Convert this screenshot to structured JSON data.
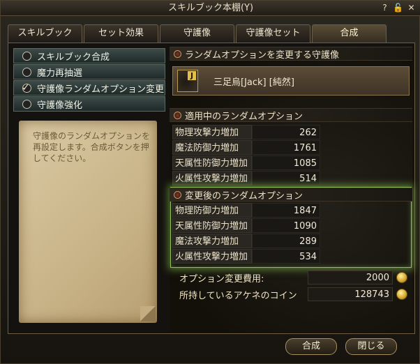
{
  "window": {
    "title": "スキルブック本棚(Y)",
    "icons": [
      "help-icon",
      "lock-icon",
      "close-icon"
    ],
    "icon_glyphs": [
      "?",
      "🔓",
      "✕"
    ]
  },
  "tabs": [
    {
      "label": "スキルブック",
      "active": false
    },
    {
      "label": "セット効果",
      "active": false
    },
    {
      "label": "守護像",
      "active": false
    },
    {
      "label": "守護像セット",
      "active": false
    },
    {
      "label": "合成",
      "active": true
    }
  ],
  "left_menu": [
    {
      "label": "スキルブック合成",
      "selected": false
    },
    {
      "label": "魔力再抽選",
      "selected": false
    },
    {
      "label": "守護像ランダムオプション変更",
      "selected": true
    },
    {
      "label": "守護像強化",
      "selected": false
    }
  ],
  "description": "守護像のランダムオプションを再設定します。合成ボタンを押してください。",
  "right": {
    "target_header": "ランダムオプションを変更する守護像",
    "guardian_badge": "J",
    "guardian_name": "三足烏[Jack] [純然]",
    "current_header": "適用中のランダムオプション",
    "current_options": [
      {
        "label": "物理攻撃力増加",
        "value": "262"
      },
      {
        "label": "魔法防御力増加",
        "value": "1761"
      },
      {
        "label": "天属性防御力増加",
        "value": "1085"
      },
      {
        "label": "火属性攻撃力増加",
        "value": "514"
      }
    ],
    "new_header": "変更後のランダムオプション",
    "new_options": [
      {
        "label": "物理防御力増加",
        "value": "1847"
      },
      {
        "label": "天属性防御力増加",
        "value": "1090"
      },
      {
        "label": "魔法攻撃力増加",
        "value": "289"
      },
      {
        "label": "火属性攻撃力増加",
        "value": "534"
      }
    ],
    "cost_label": "オプション変更費用:",
    "cost_value": "2000",
    "coins_label": "所持しているアケネのコイン",
    "coins_value": "128743"
  },
  "buttons": {
    "combine": "合成",
    "close": "閉じる"
  },
  "colors": {
    "highlight_glow": "#8fbf5e",
    "coin": "#d3a52a"
  }
}
